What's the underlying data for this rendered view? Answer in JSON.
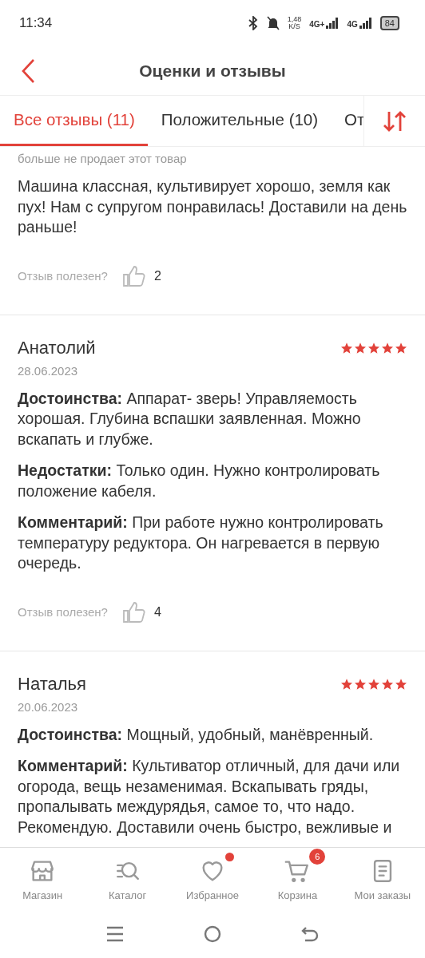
{
  "status_bar": {
    "time": "11:34",
    "speed": "1,48",
    "speed_unit": "K/S",
    "network_1": "4G+",
    "network_2": "4G",
    "battery": "84"
  },
  "header": {
    "title": "Оценки и отзывы"
  },
  "tabs": [
    {
      "label": "Все отзывы (11)",
      "selected": true
    },
    {
      "label": "Положительные (10)",
      "selected": false
    },
    {
      "label": "От",
      "selected": false
    }
  ],
  "reviews": [
    {
      "note": "больше не продает этот товар",
      "sections": [
        {
          "text": "Машина классная, культивирует хорошо, земля как пух! Нам с супругом понравилась! Доставили на день раньше!"
        }
      ],
      "helpful": "Отзыв полезен?",
      "likes": "2"
    },
    {
      "name": "Анатолий",
      "date": "28.06.2023",
      "stars": 5,
      "sections": [
        {
          "text": "**Достоинства:** Аппарат- зверь! Управляемость хорошая. Глубина вспашки заявленная. Можно вскапать и глубже."
        },
        {
          "text": "**Недостатки:** Только один. Нужно контролировать положение кабеля."
        },
        {
          "text": "**Комментарий:** При работе нужно контролировать температуру редуктора. Он нагревается в первую очередь."
        }
      ],
      "helpful": "Отзыв полезен?",
      "likes": "4"
    },
    {
      "name": "Наталья",
      "date": "20.06.2023",
      "stars": 5,
      "sections": [
        {
          "text": "**Достоинства:** Мощный, удобный, манёвренный."
        },
        {
          "text": "**Комментарий:** Культиватор отличный, для дачи или огорода, вещь незаменимая. Вскапывать гряды, пропалывать междурядья, самое то, что надо. Рекомендую. Доставили очень быстро, вежливые и"
        }
      ]
    }
  ],
  "bottom_nav": [
    {
      "kind": "shop",
      "label": "Магазин",
      "dot": false
    },
    {
      "kind": "catalog",
      "label": "Каталог",
      "dot": false
    },
    {
      "kind": "favorites",
      "label": "Избранное",
      "dot": true
    },
    {
      "kind": "cart",
      "label": "Корзина",
      "dot": false,
      "badge": "6"
    },
    {
      "kind": "orders",
      "label": "Мои заказы",
      "dot": false
    }
  ]
}
